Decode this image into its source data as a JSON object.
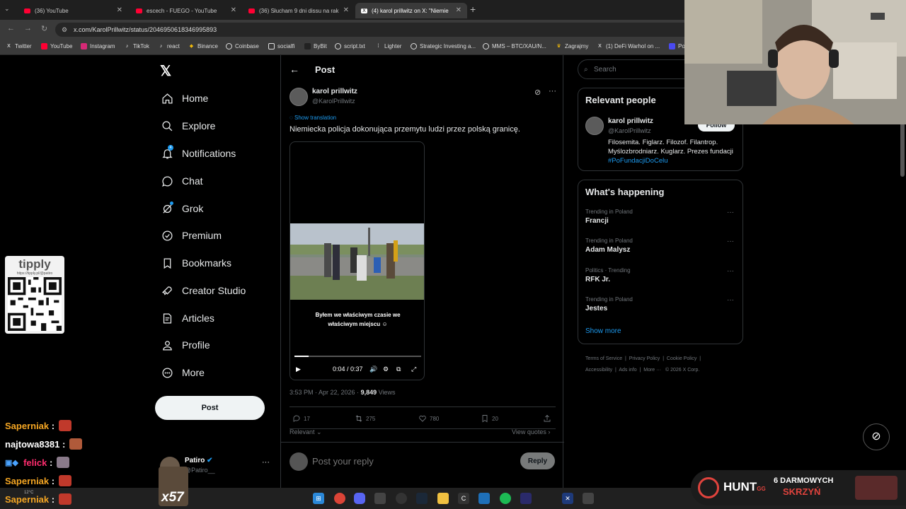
{
  "browser": {
    "tabs": [
      {
        "label": "(36) YouTube",
        "color": "#ff0033"
      },
      {
        "label": "escech - FUEGO - YouTube",
        "color": "#ff0033"
      },
      {
        "label": "(36) Słucham 9 dni dissu na rak",
        "color": "#ff0033"
      },
      {
        "label": "(4) karol prillwitz on X: \"Niemie",
        "color": "#ffffff"
      }
    ],
    "url": "x.com/KarolPrillwitz/status/2046950618346995893",
    "bookmarks": [
      "Twitter",
      "YouTube",
      "Instagram",
      "TikTok",
      "react",
      "Binance",
      "Coinbase",
      "socialfi",
      "ByBit",
      "script.txt",
      "Lighter",
      "Strategic Investing a...",
      "MMS – BTC/XAU/N...",
      "Zagrajmy",
      "(1) DeFi Warhol on ...",
      "Po"
    ]
  },
  "nav": {
    "items": [
      "Home",
      "Explore",
      "Notifications",
      "Chat",
      "Grok",
      "Premium",
      "Bookmarks",
      "Creator Studio",
      "Articles",
      "Profile",
      "More"
    ],
    "notif_badge": "4",
    "post_label": "Post",
    "account_name": "Patiro",
    "account_handle": "@Patiro__"
  },
  "post": {
    "header": "Post",
    "author_name": "karol prillwitz",
    "author_handle": "@KarolPrillwitz",
    "show_translation": "Show translation",
    "text": "Niemiecka policja dokonująca przemytu ludzi przez polską granicę.",
    "video_caption_1": "Byłem we właściwym czasie we",
    "video_caption_2": "właściwym miejscu",
    "video_time": "0:04 / 0:37",
    "video_progress": 0.11,
    "time": "3:53 PM · Apr 22, 2026 · ",
    "views_count": "9,849",
    "views_label": " Views",
    "replies": "17",
    "reposts": "275",
    "likes": "780",
    "bookmarks": "20",
    "relevant": "Relevant",
    "view_quotes": "View quotes",
    "reply_placeholder": "Post your reply",
    "reply_btn": "Reply"
  },
  "sidebar": {
    "search_placeholder": "Search",
    "relevant_title": "Relevant people",
    "rp_name": "karol prillwitz",
    "rp_handle": "@KarolPrillwitz",
    "follow": "Follow",
    "bio": "Filosemita. Figlarz. Filozof. Filantrop. Myślozbrodniarz. Kuglarz. Prezes fundacji ",
    "bio_tag": "#PoFundacjiDoCelu",
    "happening_title": "What's happening",
    "trends": [
      {
        "cat": "Trending in Poland",
        "name": "Francji"
      },
      {
        "cat": "Trending in Poland",
        "name": "Adam Malysz"
      },
      {
        "cat": "Politics · Trending",
        "name": "RFK Jr."
      },
      {
        "cat": "Trending in Poland",
        "name": "Jestes"
      }
    ],
    "show_more": "Show more",
    "footer": [
      "Terms of Service",
      "Privacy Policy",
      "Cookie Policy",
      "Accessibility",
      "Ads info",
      "More ···",
      "© 2026 X Corp."
    ]
  },
  "stream": {
    "tipply": "tipply",
    "tipply_url": "https://tipply.pl/@patiro",
    "chat": [
      {
        "user": "Saperniak",
        "color": "#f5a623"
      },
      {
        "user": "najtowa8381",
        "color": "#ffffff"
      },
      {
        "user": "felick",
        "color": "#ff2d6f"
      },
      {
        "user": "Saperniak",
        "color": "#f5a623"
      },
      {
        "user": "Saperniak",
        "color": "#f5a623"
      }
    ],
    "x57": "x57",
    "weather": "12°C",
    "hunt": "HUNT",
    "hunt_gg": "GG",
    "promo_1": "6 DARMOWYCH",
    "promo_2": "SKRZYŃ"
  }
}
